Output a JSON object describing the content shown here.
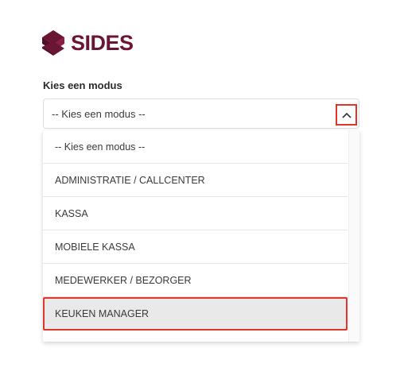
{
  "brand": {
    "name": "SIDES",
    "color": "#6b1535"
  },
  "form": {
    "label": "Kies een modus",
    "selected_value": "-- Kies een modus --"
  },
  "dropdown": {
    "options": [
      "-- Kies een modus --",
      "ADMINISTRATIE / CALLCENTER",
      "KASSA",
      "MOBIELE KASSA",
      "MEDEWERKER / BEZORGER",
      "KEUKEN MANAGER"
    ],
    "highlighted_option": "KEUKEN MANAGER"
  },
  "colors": {
    "highlight_border": "#e0362a",
    "option_hover_bg": "#e9e9e9"
  },
  "icons": {
    "toggle": "chevron-up-icon",
    "logo": "sides-logo-mark"
  }
}
